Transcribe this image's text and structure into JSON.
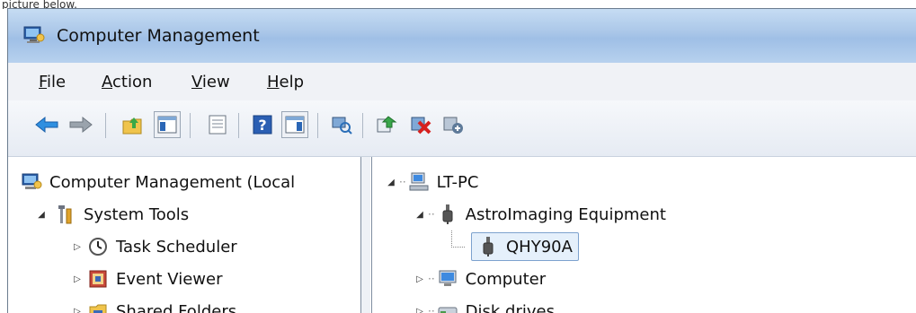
{
  "caption": "picture below.",
  "window": {
    "title": "Computer Management"
  },
  "menu": [
    {
      "label": "File",
      "accel": "F",
      "rest": "ile"
    },
    {
      "label": "Action",
      "accel": "A",
      "rest": "ction"
    },
    {
      "label": "View",
      "accel": "V",
      "rest": "iew"
    },
    {
      "label": "Help",
      "accel": "H",
      "rest": "elp"
    }
  ],
  "toolbar": {
    "icons": [
      "back-arrow-icon",
      "forward-arrow-icon",
      "up-folder-icon",
      "show-console-tree-icon",
      "properties-icon",
      "help-icon",
      "show-action-pane-icon",
      "scan-hardware-icon",
      "update-driver-icon",
      "uninstall-device-icon",
      "disable-device-icon"
    ]
  },
  "left_tree": {
    "root": "Computer Management (Local",
    "system_tools": "System Tools",
    "task_scheduler": "Task Scheduler",
    "event_viewer": "Event Viewer",
    "shared_folders": "Shared Folders"
  },
  "right_tree": {
    "pc": "LT-PC",
    "category": "AstroImaging Equipment",
    "device": "QHY90A",
    "computer": "Computer",
    "disk_drives": "Disk drives"
  },
  "colors": {
    "accent": "#1d6fd6",
    "selection": "#e5f0fb",
    "title_gradient": "#a9c6e8"
  }
}
